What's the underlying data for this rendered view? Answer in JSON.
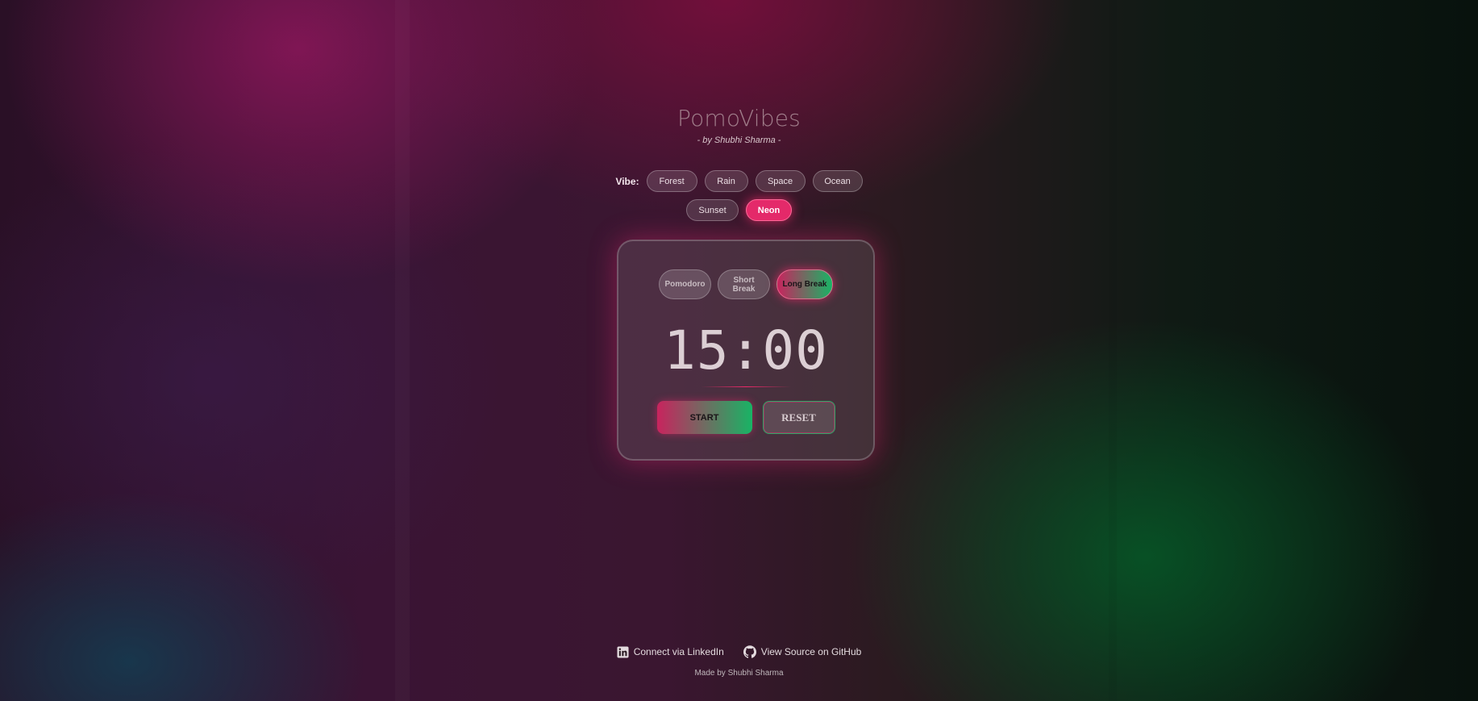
{
  "app": {
    "title": "PomoVibes",
    "byline": "- by Shubhi Sharma -"
  },
  "vibes": {
    "label": "Vibe:",
    "items": [
      "Forest",
      "Rain",
      "Space",
      "Ocean",
      "Sunset",
      "Neon"
    ],
    "selected": "Neon"
  },
  "timer": {
    "modes": [
      {
        "label": "Pomodoro"
      },
      {
        "label": "Short Break"
      },
      {
        "label": "Long Break"
      }
    ],
    "selected_mode": "Long Break",
    "display": "15:00",
    "start_label": "START",
    "reset_label": "RESET"
  },
  "footer": {
    "linkedin_label": "Connect via LinkedIn",
    "github_label": "View Source on GitHub",
    "made_by": "Made by Shubhi Sharma"
  },
  "colors": {
    "accent_pink": "#e42a6a",
    "accent_green": "#18b465"
  },
  "icons": {
    "linkedin": "linkedin-icon",
    "github": "github-icon"
  }
}
